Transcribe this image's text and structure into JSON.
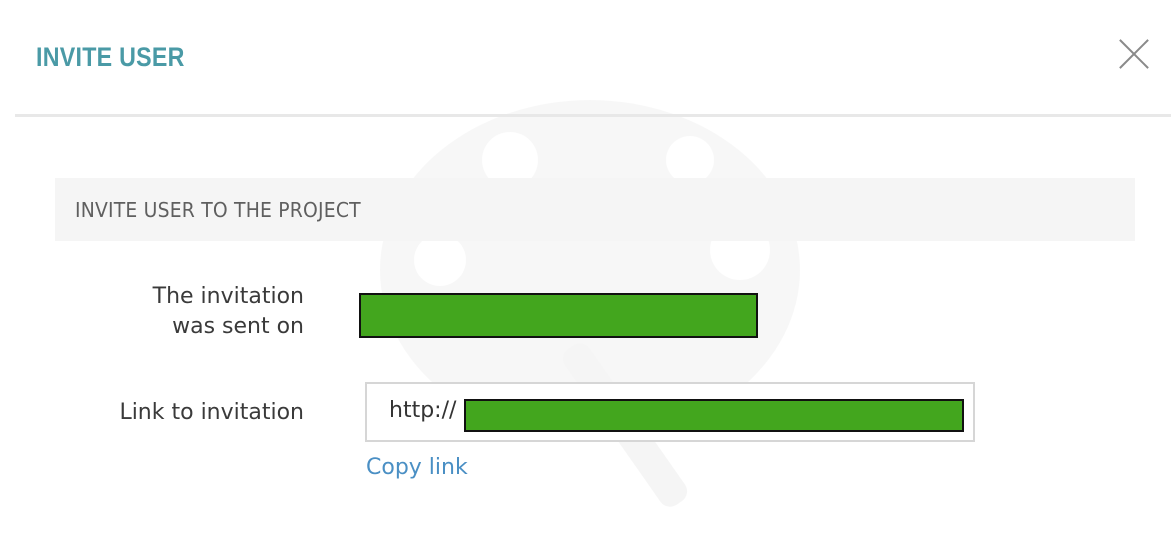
{
  "dialog": {
    "title": "INVITE USER",
    "close_icon": "close-icon"
  },
  "section": {
    "title": "INVITE USER TO THE PROJECT"
  },
  "fields": {
    "sent_on_label": "The invitation\nwas sent on",
    "link_label": "Link to invitation",
    "link_prefix": "http://"
  },
  "actions": {
    "copy_link": "Copy link"
  },
  "colors": {
    "title": "#4a9aa6",
    "link": "#4a8fc4",
    "redaction": "#43a61e"
  }
}
